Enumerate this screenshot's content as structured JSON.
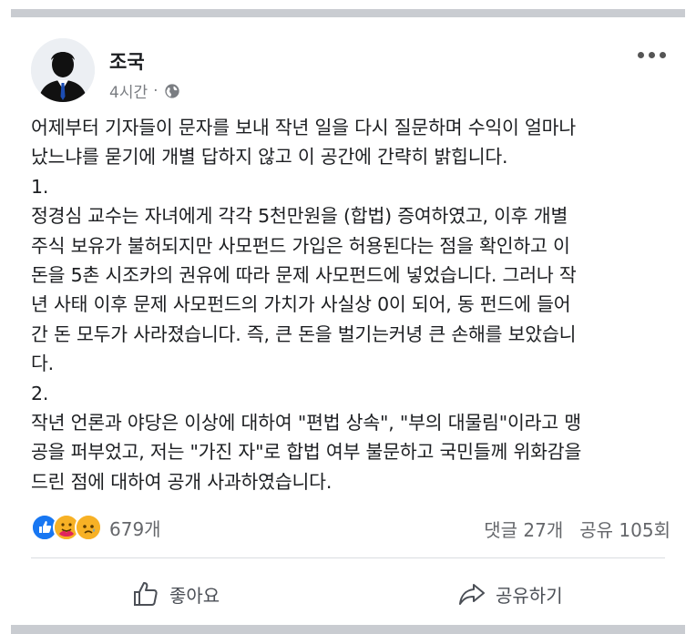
{
  "post": {
    "author": "조국",
    "time": "4시간",
    "separator": "·",
    "lines": [
      "어제부터 기자들이 문자를 보내 작년 일을 다시 질문하며 수익이 얼마나",
      "났느냐를 묻기에 개별 답하지 않고 이 공간에 간략히 밝힙니다.",
      "1.",
      "정경심 교수는 자녀에게 각각 5천만원을 (합법) 증여하였고, 이후 개별",
      "주식 보유가 불허되지만 사모펀드 가입은 허용된다는 점을 확인하고 이",
      "돈을 5촌 시조카의 권유에 따라 문제 사모펀드에 넣었습니다. 그러나 작",
      "년 사태 이후 문제 사모펀드의 가치가 사실상 0이 되어, 동 펀드에 들어",
      "간 돈 모두가 사라졌습니다. 즉, 큰 돈을 벌기는커녕 큰 손해를 보았습니",
      "다.",
      "2.",
      "작년 언론과 야당은 이상에 대하여 \"편법 상속\", \"부의 대물림\"이라고 맹",
      "공을 퍼부었고, 저는 \"가진 자\"로 합법 여부 불문하고 국민들께 위화감을",
      "드린 점에 대하여 공개 사과하였습니다."
    ]
  },
  "reactions": {
    "count": "679개",
    "icons": [
      "like-icon",
      "care-icon",
      "sad-icon"
    ],
    "colors": {
      "like": "#1877f2",
      "emoji": "#f7b125"
    }
  },
  "stats": {
    "comments": "댓글 27개",
    "shares": "공유 105회"
  },
  "actions": {
    "like": "좋아요",
    "share": "공유하기"
  }
}
